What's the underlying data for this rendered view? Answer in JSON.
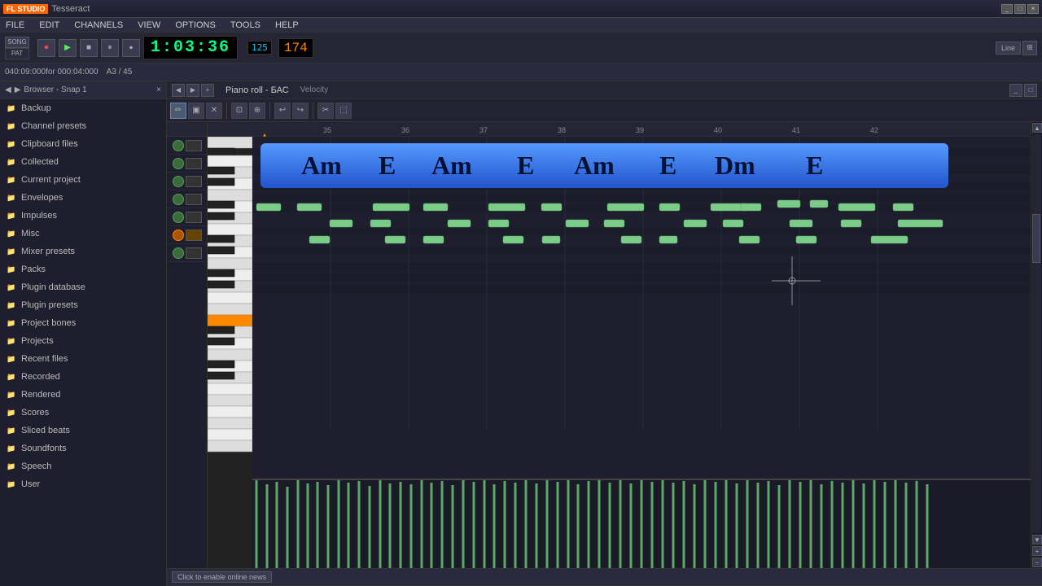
{
  "titleBar": {
    "logoText": "FL STUDIO",
    "projectName": "Tesseract",
    "winBtns": [
      "_",
      "□",
      "×"
    ]
  },
  "menuBar": {
    "items": [
      "FILE",
      "EDIT",
      "CHANNELS",
      "VIEW",
      "OPTIONS",
      "TOOLS",
      "HELP"
    ]
  },
  "transportBar": {
    "timeDisplay": "1:03:36",
    "bpm": "174",
    "patternNum": "125",
    "buttons": [
      "▶▶",
      "●",
      "▶",
      "■",
      "⏺"
    ]
  },
  "statusBar": {
    "position": "040:09:000",
    "duration": "for 000:04:000",
    "note": "A3 / 45"
  },
  "sidebar": {
    "header": "Browser - Snap 1",
    "items": [
      {
        "label": "Backup",
        "icon": "📁"
      },
      {
        "label": "Channel presets",
        "icon": "📁"
      },
      {
        "label": "Clipboard files",
        "icon": "📁"
      },
      {
        "label": "Collected",
        "icon": "📁"
      },
      {
        "label": "Current project",
        "icon": "📁"
      },
      {
        "label": "Envelopes",
        "icon": "📁"
      },
      {
        "label": "Impulses",
        "icon": "📁"
      },
      {
        "label": "Misc",
        "icon": "📁"
      },
      {
        "label": "Mixer presets",
        "icon": "📁"
      },
      {
        "label": "Packs",
        "icon": "📁"
      },
      {
        "label": "Plugin database",
        "icon": "📁"
      },
      {
        "label": "Plugin presets",
        "icon": "📁"
      },
      {
        "label": "Project bones",
        "icon": "📁"
      },
      {
        "label": "Projects",
        "icon": "📁"
      },
      {
        "label": "Recent files",
        "icon": "📁"
      },
      {
        "label": "Recorded",
        "icon": "📁"
      },
      {
        "label": "Rendered",
        "icon": "📁"
      },
      {
        "label": "Scores",
        "icon": "📁"
      },
      {
        "label": "Sliced beats",
        "icon": "📁"
      },
      {
        "label": "Soundfonts",
        "icon": "📁"
      },
      {
        "label": "Speech",
        "icon": "📁"
      },
      {
        "label": "User",
        "icon": "📁"
      }
    ]
  },
  "newsBar": {
    "buttonLabel": "Click to enable online news"
  },
  "pianoRoll": {
    "title": "Piano roll - БАС",
    "velocityLabel": "Velocity",
    "chordText": "Am   E      Am   E      Am   E      Dm   E",
    "timeMarkers": [
      "35",
      "36",
      "37",
      "38",
      "39",
      "40",
      "41",
      "42"
    ],
    "tools": [
      "✏",
      "☰",
      "↗",
      "⛶",
      "⟲",
      "⟳",
      "✂",
      "⬚"
    ]
  }
}
